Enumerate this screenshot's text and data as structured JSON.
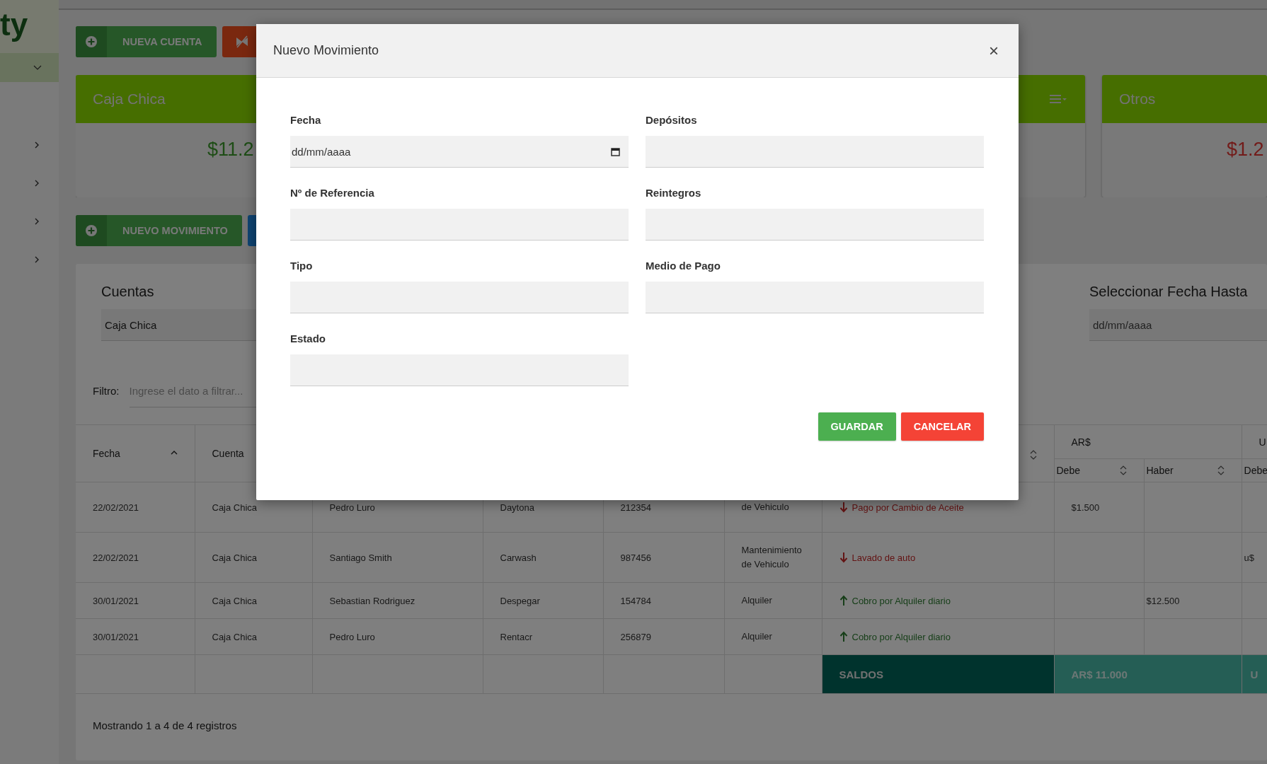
{
  "sidebar": {
    "logo": "ty",
    "items": [
      {
        "expanded": false
      },
      {
        "expanded": false
      },
      {
        "expanded": false
      },
      {
        "expanded": false
      }
    ]
  },
  "toolbar_buttons": [
    {
      "kind": "add",
      "label": "NUEVA CUENTA"
    },
    {
      "kind": "danger"
    }
  ],
  "account_cards": [
    {
      "title": "Caja Chica",
      "balance": "$11.2",
      "negative": false
    },
    {
      "has_menu": true
    },
    {
      "title": "Otros",
      "balance": "$1.2",
      "negative": true
    }
  ],
  "movement_buttons": [
    {
      "kind": "add",
      "label": "NUEVO MOVIMIENTO"
    },
    {
      "kind": "info"
    }
  ],
  "filters": {
    "account": {
      "label": "Cuentas",
      "value": "Caja Chica"
    },
    "date_to": {
      "label": "Seleccionar Fecha Hasta",
      "placeholder": "dd/mm/aaaa"
    },
    "search": {
      "label": "Filtro:",
      "placeholder": "Ingrese el dato a filtrar..."
    }
  },
  "table": {
    "columns": [
      {
        "label": "Fecha",
        "sorted": true
      },
      {
        "label": "Cuenta"
      }
    ],
    "column_8": {
      "sortable": true,
      "sorted": false
    },
    "groups": [
      {
        "label": "AR$",
        "columns": [
          {
            "label": "Debe",
            "sortable": true,
            "sorted": false
          },
          {
            "label": "Haber",
            "sortable": true,
            "sorted": false
          }
        ]
      },
      {
        "label": "U",
        "columns": [
          {
            "label": "Debe",
            "sortable": false,
            "sorted": false
          }
        ]
      }
    ],
    "rows": [
      {
        "fecha": "22/02/2021",
        "cuenta": "Caja Chica",
        "column_3": "Pedro Luro",
        "column_4": "Daytona",
        "column_5": "212354",
        "column_6": "de Vehiculo",
        "description": {
          "text": "Pago por Cambio de Aceite",
          "incoming": false
        },
        "ars_debe": "$1.500"
      },
      {
        "fecha": "22/02/2021",
        "cuenta": "Caja Chica",
        "column_3": "Santiago Smith",
        "column_4": "Carwash",
        "column_5": "987456",
        "column_6": "Mantenimiento de Vehiculo",
        "description": {
          "text": "Lavado de auto",
          "incoming": false
        },
        "usd_debe": "u$"
      },
      {
        "fecha": "30/01/2021",
        "cuenta": "Caja Chica",
        "column_3": "Sebastian Rodriguez",
        "column_4": "Despegar",
        "column_5": "154784",
        "column_6": "Alquiler",
        "description": {
          "text": "Cobro por Alquiler diario",
          "incoming": true
        },
        "ars_haber": "$12.500"
      },
      {
        "fecha": "30/01/2021",
        "cuenta": "Caja Chica",
        "column_3": "Pedro Luro",
        "column_4": "Rentacr",
        "column_5": "256879",
        "column_6": "Alquiler",
        "description": {
          "text": "Cobro por Alquiler diario",
          "incoming": true
        }
      }
    ],
    "totals": {
      "label": "SALDOS",
      "ars": "AR$ 11.000",
      "usd": "U"
    },
    "footer": "Mostrando 1 a 4 de 4 registros"
  },
  "modal": {
    "title": "Nuevo Movimiento",
    "close": "×",
    "fields": [
      {
        "label": "Fecha",
        "kind": "date",
        "placeholder": "dd/mm/aaaa"
      },
      {
        "label": "Depósitos",
        "kind": "text"
      },
      {
        "label": "Nº de Referencia",
        "kind": "text"
      },
      {
        "label": "Reintegros",
        "kind": "text"
      },
      {
        "label": "Tipo",
        "kind": "text"
      },
      {
        "label": "Medio de Pago",
        "kind": "text"
      },
      {
        "label": "Estado",
        "kind": "text"
      }
    ],
    "buttons": [
      {
        "label": "GUARDAR",
        "kind": "primary"
      },
      {
        "label": "CANCELAR",
        "kind": "danger"
      }
    ]
  }
}
